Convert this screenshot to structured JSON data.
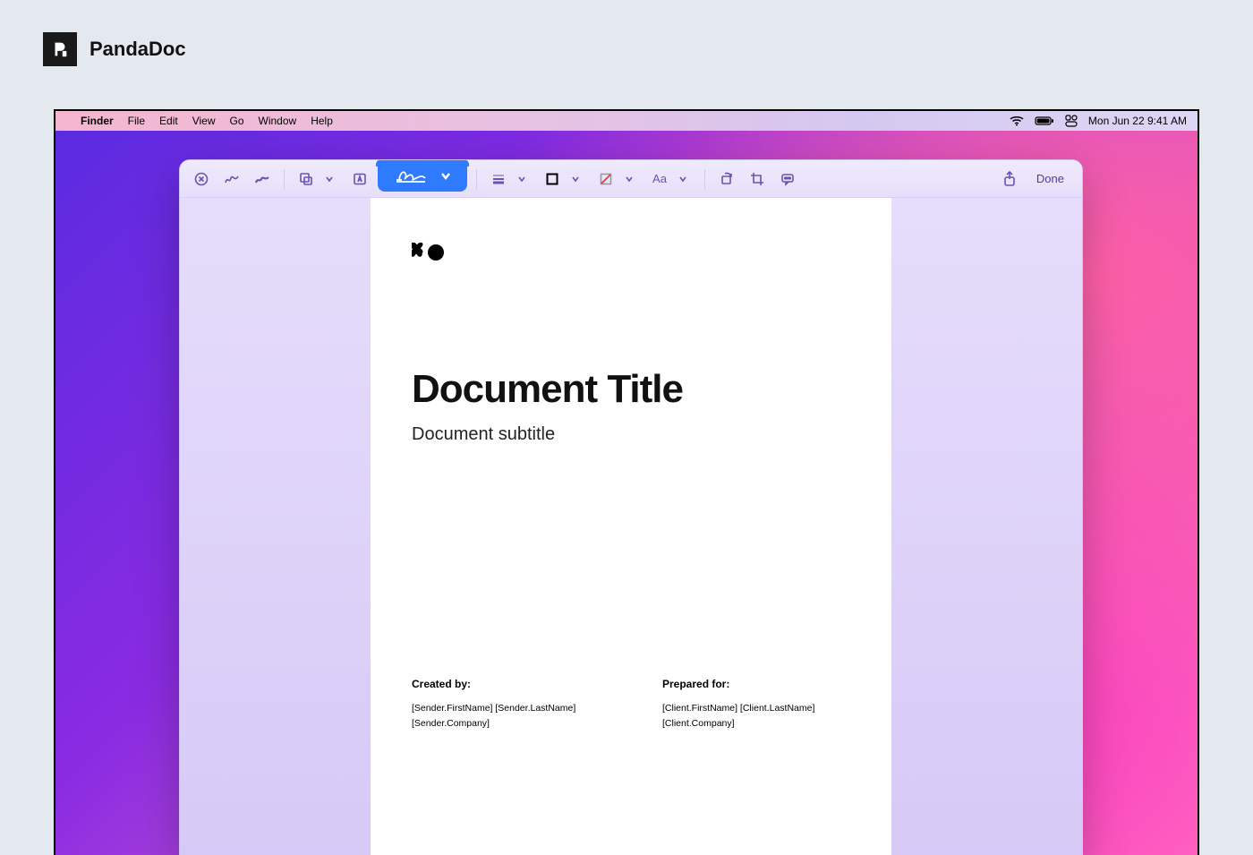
{
  "brand": {
    "logo_text": "pd",
    "name": "PandaDoc"
  },
  "mac_menubar": {
    "app_name": "Finder",
    "menus": [
      "File",
      "Edit",
      "View",
      "Go",
      "Window",
      "Help"
    ],
    "datetime": "Mon Jun 22  9:41 AM"
  },
  "toolbar": {
    "done_label": "Done",
    "text_style_label": "Aa"
  },
  "document": {
    "logo_glyph": "✖●",
    "title": "Document Title",
    "subtitle": "Document subtitle",
    "created_by": {
      "heading": "Created by:",
      "line1": "[Sender.FirstName] [Sender.LastName]",
      "line2": "[Sender.Company]"
    },
    "prepared_for": {
      "heading": "Prepared for:",
      "line1": "[Client.FirstName] [Client.LastName]",
      "line2": "[Client.Company]"
    }
  }
}
